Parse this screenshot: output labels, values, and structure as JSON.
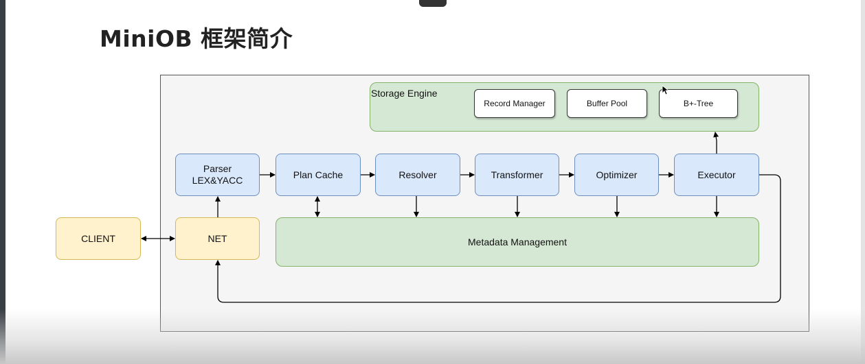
{
  "title": "MiniOB 框架简介",
  "diagram": {
    "storage_engine": {
      "label": "Storage Engine",
      "components": [
        "Record Manager",
        "Buffer Pool",
        "B+-Tree"
      ]
    },
    "pipeline": [
      "Parser\nLEX&YACC",
      "Plan Cache",
      "Resolver",
      "Transformer",
      "Optimizer",
      "Executor"
    ],
    "client": "CLIENT",
    "net": "NET",
    "metadata": "Metadata Management"
  },
  "colors": {
    "blue_fill": "#dae8fc",
    "blue_border": "#6c8ebf",
    "yellow_fill": "#fff2cc",
    "yellow_border": "#d6b656",
    "green_fill": "#d5e8d4",
    "green_border": "#82b366"
  }
}
